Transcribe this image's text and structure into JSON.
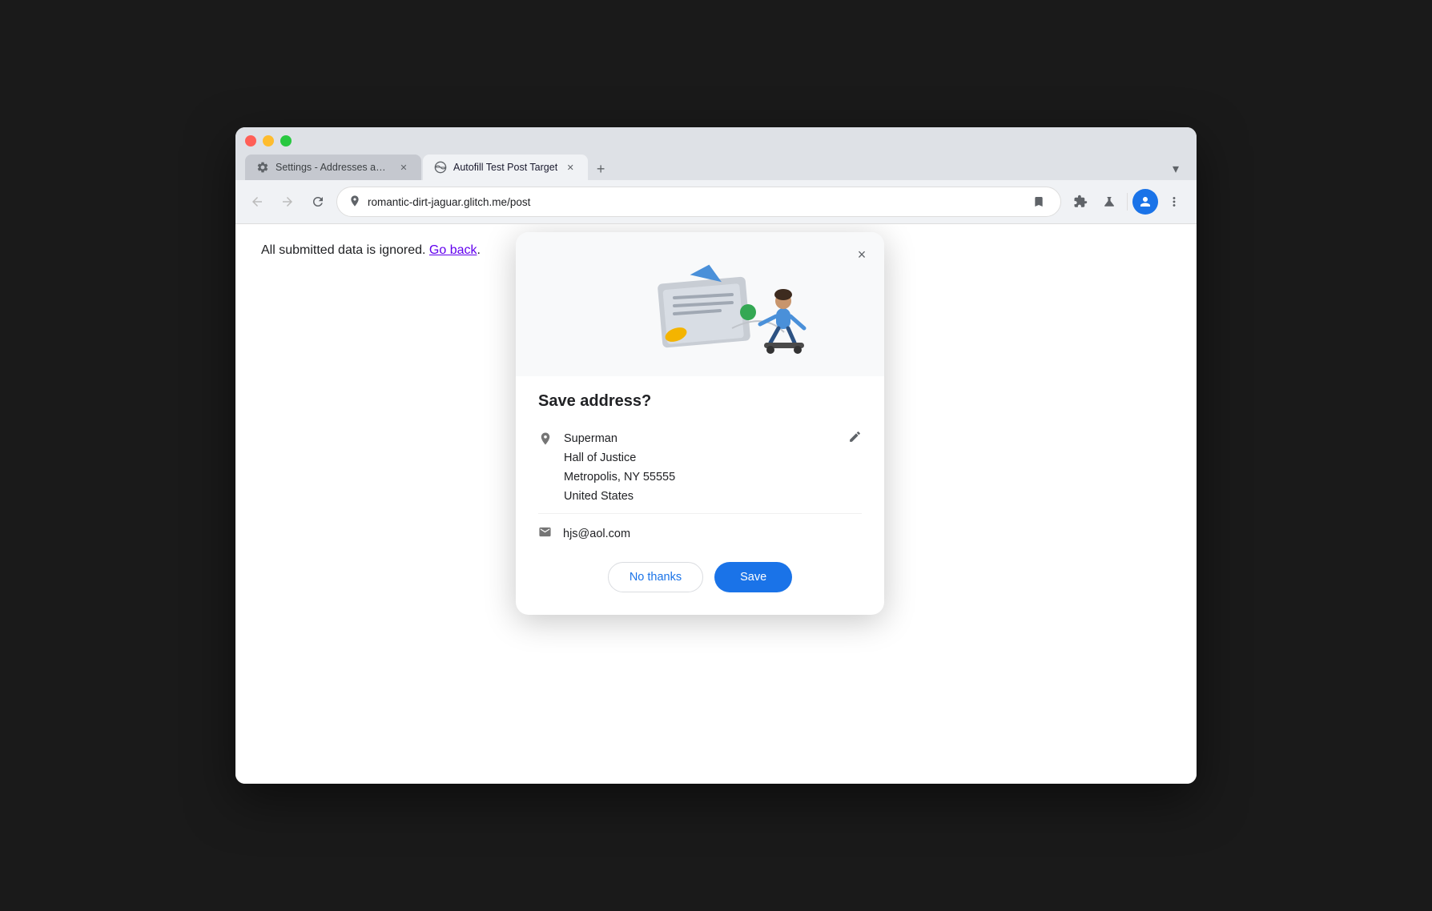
{
  "browser": {
    "tabs": [
      {
        "id": "tab-settings",
        "title": "Settings - Addresses and mo",
        "icon": "gear",
        "active": false,
        "closable": true
      },
      {
        "id": "tab-autofill",
        "title": "Autofill Test Post Target",
        "icon": "globe",
        "active": true,
        "closable": true
      }
    ],
    "new_tab_label": "+",
    "dropdown_label": "▾",
    "nav": {
      "back_title": "Back",
      "forward_title": "Forward",
      "reload_title": "Reload",
      "url": "romantic-dirt-jaguar.glitch.me/post",
      "bookmark_title": "Bookmark",
      "extensions_title": "Extensions",
      "labs_title": "Labs",
      "profile_title": "Profile",
      "more_title": "More"
    }
  },
  "page": {
    "body_text": "All submitted data is ignored.",
    "go_back_link": "Go back"
  },
  "popup": {
    "close_label": "×",
    "title": "Save address?",
    "address": {
      "name": "Superman",
      "line1": "Hall of Justice",
      "line2": "Metropolis, NY 55555",
      "line3": "United States"
    },
    "email": "hjs@aol.com",
    "no_thanks_label": "No thanks",
    "save_label": "Save"
  }
}
